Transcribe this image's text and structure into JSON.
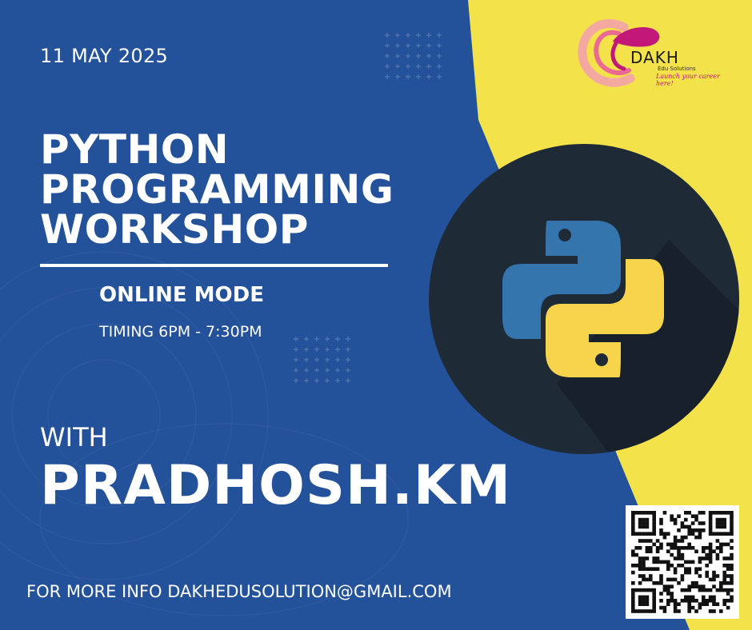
{
  "event": {
    "date": "11 MAY 2025",
    "title_lines": [
      "PYTHON",
      "PROGRAMMING",
      "WORKSHOP"
    ],
    "mode": "ONLINE MODE",
    "timing": "TIMING 6PM - 7:30PM",
    "with_label": "WITH",
    "speaker": "PRADHOSH.KM",
    "contact": "FOR MORE INFO DAKHEDUSOLUTION@GMAIL.COM"
  },
  "logo": {
    "name": "DAKH",
    "subtitle": "Edu Solutions",
    "tagline": "Launch your career here!"
  },
  "icons": {
    "emblem": "python-logo-icon",
    "qr": "qr-code-icon"
  },
  "colors": {
    "background_blue": "#23529a",
    "accent_yellow": "#f3e24a",
    "emblem_dark": "#1f2a37",
    "python_blue": "#3475ad",
    "python_yellow": "#f7d44c",
    "logo_magenta": "#c2187a"
  }
}
